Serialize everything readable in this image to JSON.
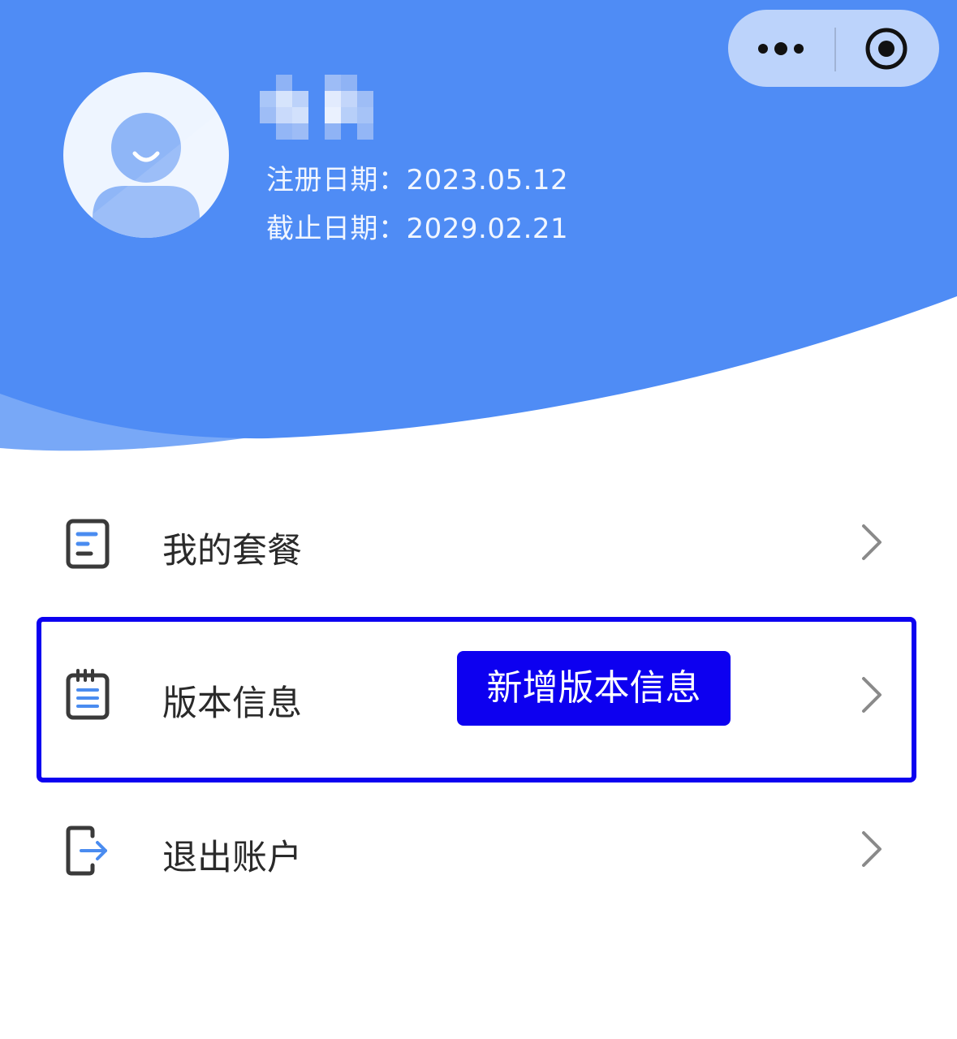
{
  "profile": {
    "username": "用户",
    "register_date_label": "注册日期：",
    "register_date": "2023.05.12",
    "expiry_date_label": "截止日期：",
    "expiry_date": "2029.02.21"
  },
  "capsule": {
    "more_icon": "more-dots-icon",
    "close_icon": "target-close-icon"
  },
  "menu": {
    "items": [
      {
        "label": "我的套餐",
        "icon": "package-doc-icon"
      },
      {
        "label": "版本信息",
        "icon": "version-notepad-icon"
      },
      {
        "label": "退出账户",
        "icon": "logout-icon"
      }
    ]
  },
  "annotation": {
    "badge_text": "新增版本信息"
  },
  "colors": {
    "header_blue": "#4f8cf5",
    "wave_light": "#78a8f7",
    "highlight": "#0d00f0",
    "icon_dark": "#3a3a3a",
    "icon_blue": "#4a8cf0"
  }
}
